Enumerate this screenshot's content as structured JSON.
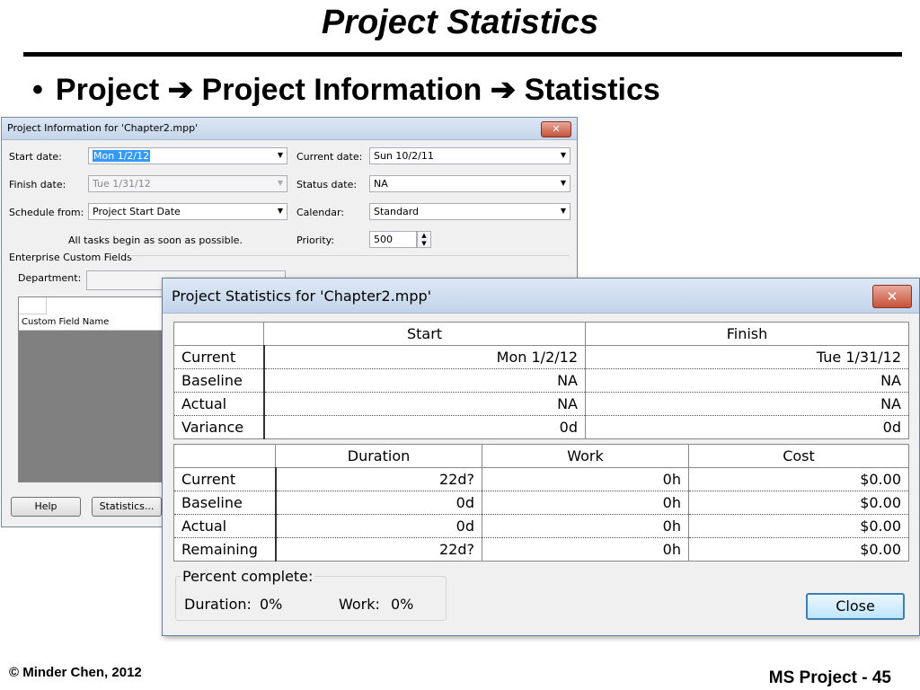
{
  "slide": {
    "title": "Project Statistics",
    "bullet": "Project ➔ Project Information ➔ Statistics",
    "footer_left": "© Minder Chen, 2012",
    "footer_right": "MS Project - 45"
  },
  "project_info_dialog": {
    "title": "Project Information for 'Chapter2.mpp'",
    "close_glyph": "✕",
    "start_date_label": "Start date:",
    "start_date_value": "Mon 1/2/12",
    "finish_date_label": "Finish date:",
    "finish_date_value": "Tue 1/31/12",
    "schedule_from_label": "Schedule from:",
    "schedule_from_value": "Project Start Date",
    "schedule_note": "All tasks begin as soon as possible.",
    "current_date_label": "Current date:",
    "current_date_value": "Sun 10/2/11",
    "status_date_label": "Status date:",
    "status_date_value": "NA",
    "calendar_label": "Calendar:",
    "calendar_value": "Standard",
    "priority_label": "Priority:",
    "priority_value": "500",
    "enterprise_label": "Enterprise Custom Fields",
    "department_label": "Department:",
    "custom_field_header": "Custom Field Name",
    "help_button": "Help",
    "statistics_button": "Statistics..."
  },
  "stats_dialog": {
    "title": "Project Statistics for 'Chapter2.mpp'",
    "close_glyph": "✕",
    "dates_table": {
      "headers": [
        "",
        "Start",
        "Finish"
      ],
      "rows": [
        {
          "label": "Current",
          "start": "Mon 1/2/12",
          "finish": "Tue 1/31/12"
        },
        {
          "label": "Baseline",
          "start": "NA",
          "finish": "NA"
        },
        {
          "label": "Actual",
          "start": "NA",
          "finish": "NA"
        },
        {
          "label": "Variance",
          "start": "0d",
          "finish": "0d"
        }
      ]
    },
    "work_table": {
      "headers": [
        "",
        "Duration",
        "Work",
        "Cost"
      ],
      "rows": [
        {
          "label": "Current",
          "duration": "22d?",
          "work": "0h",
          "cost": "$0.00"
        },
        {
          "label": "Baseline",
          "duration": "0d",
          "work": "0h",
          "cost": "$0.00"
        },
        {
          "label": "Actual",
          "duration": "0d",
          "work": "0h",
          "cost": "$0.00"
        },
        {
          "label": "Remaining",
          "duration": "22d?",
          "work": "0h",
          "cost": "$0.00"
        }
      ]
    },
    "percent_complete_label": "Percent complete:",
    "duration_label": "Duration:",
    "duration_pct": "0%",
    "work_label": "Work:",
    "work_pct": "0%",
    "close_button": "Close"
  }
}
